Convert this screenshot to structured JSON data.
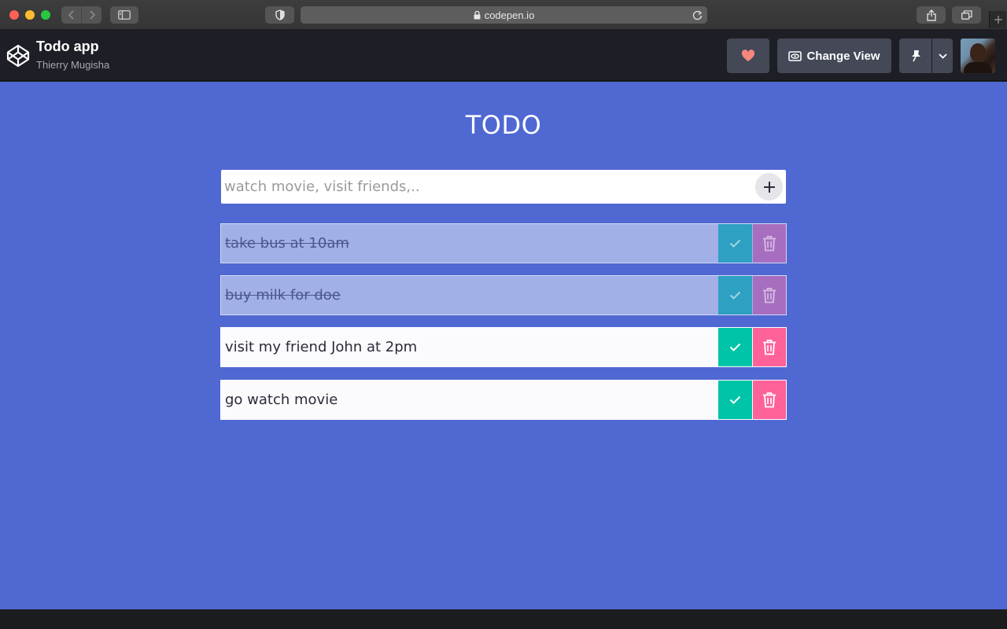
{
  "browser": {
    "url": "codepen.io",
    "colors": {
      "titlebar": "#3a3a3a",
      "address_bar": "#5d5d5d"
    }
  },
  "codepen": {
    "pen_title": "Todo app",
    "author": "Thierry Mugisha",
    "change_view_label": "Change View",
    "icons": [
      "codepen-logo-icon",
      "heart-icon",
      "eye-icon",
      "pin-icon",
      "chevron-down-icon"
    ]
  },
  "app": {
    "heading": "TODO",
    "input_placeholder": "watch movie, visit friends,..",
    "input_value": "",
    "colors": {
      "background": "#5068d2",
      "complete": "#00c4a7",
      "delete": "#ff6199"
    },
    "todos": [
      {
        "text": "take bus at 10am",
        "completed": true
      },
      {
        "text": "buy milk for doe",
        "completed": true
      },
      {
        "text": "visit my friend John at 2pm",
        "completed": false
      },
      {
        "text": "go watch movie",
        "completed": false
      }
    ]
  }
}
